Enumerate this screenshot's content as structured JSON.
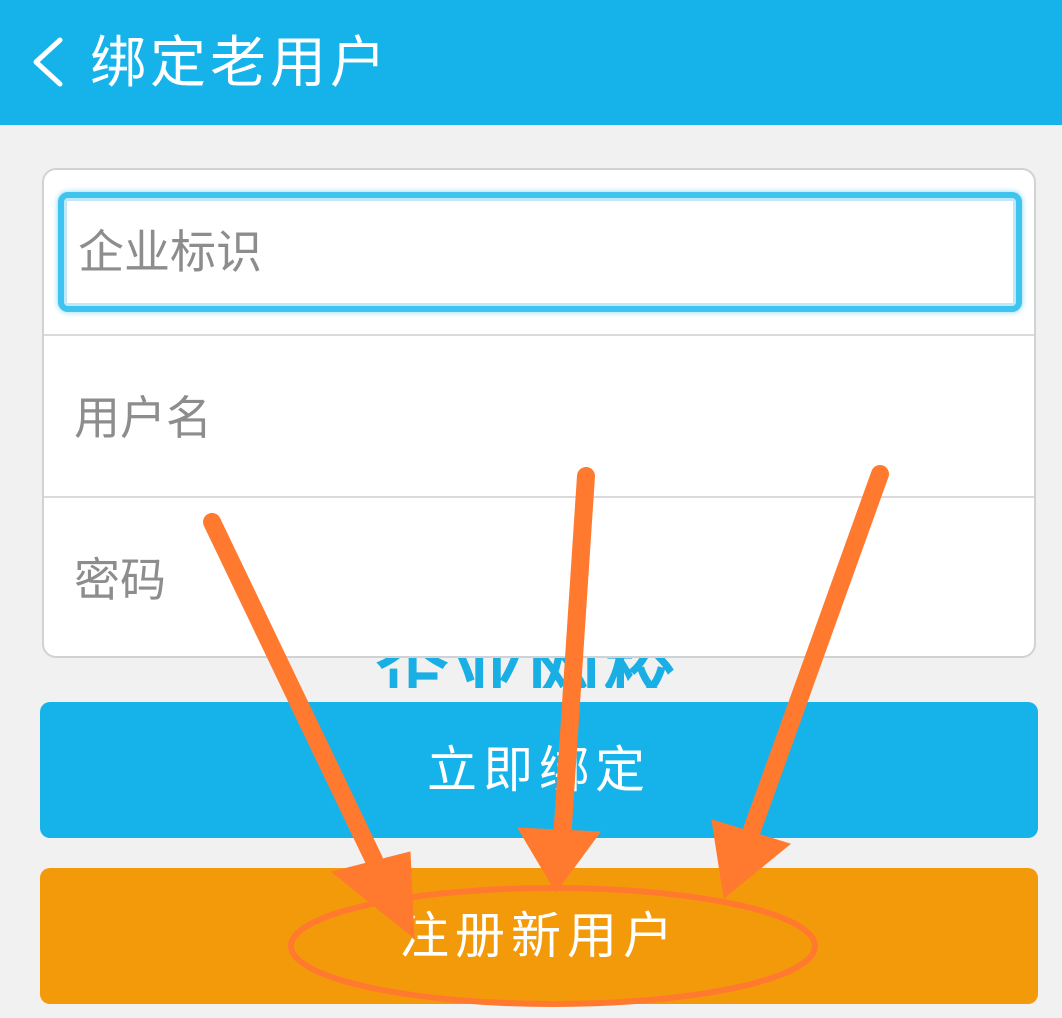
{
  "header": {
    "title": "绑定老用户",
    "back_icon": "chevron-left-icon"
  },
  "form": {
    "company_placeholder": "企业标识",
    "username_placeholder": "用户名",
    "password_placeholder": "密码"
  },
  "background_watermark": "企业网校",
  "buttons": {
    "bind_label": "立即绑定",
    "register_label": "注册新用户"
  },
  "colors": {
    "header": "#16b3ea",
    "bind_button": "#16b3ea",
    "register_button": "#f39a0b",
    "annotation": "#ff7a2f"
  }
}
